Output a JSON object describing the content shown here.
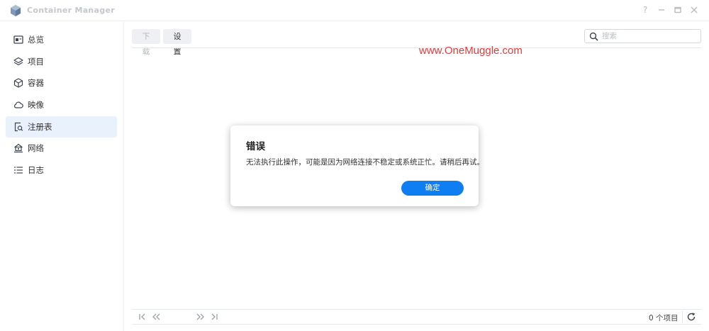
{
  "window": {
    "title": "Container Manager"
  },
  "sidebar": {
    "items": [
      {
        "label": "总览",
        "icon": "overview-icon"
      },
      {
        "label": "项目",
        "icon": "layers-icon"
      },
      {
        "label": "容器",
        "icon": "cube-icon"
      },
      {
        "label": "映像",
        "icon": "cloud-icon"
      },
      {
        "label": "注册表",
        "icon": "registry-search-icon"
      },
      {
        "label": "网络",
        "icon": "network-icon"
      },
      {
        "label": "日志",
        "icon": "list-icon"
      }
    ],
    "active_index": 4
  },
  "toolbar": {
    "download_label": "下载",
    "settings_label": "设置",
    "search_placeholder": "搜索"
  },
  "watermark": {
    "text": "www.OneMuggle.com"
  },
  "footer": {
    "count_label": "0 个项目"
  },
  "dialog": {
    "title": "错误",
    "message": "无法执行此操作，可能是因为网络连接不稳定或系统正忙。请稍后再试。",
    "ok_label": "确定"
  },
  "colors": {
    "accent": "#0f7ef2",
    "active_bg": "#e8f1fc",
    "watermark": "#e53a3a"
  }
}
